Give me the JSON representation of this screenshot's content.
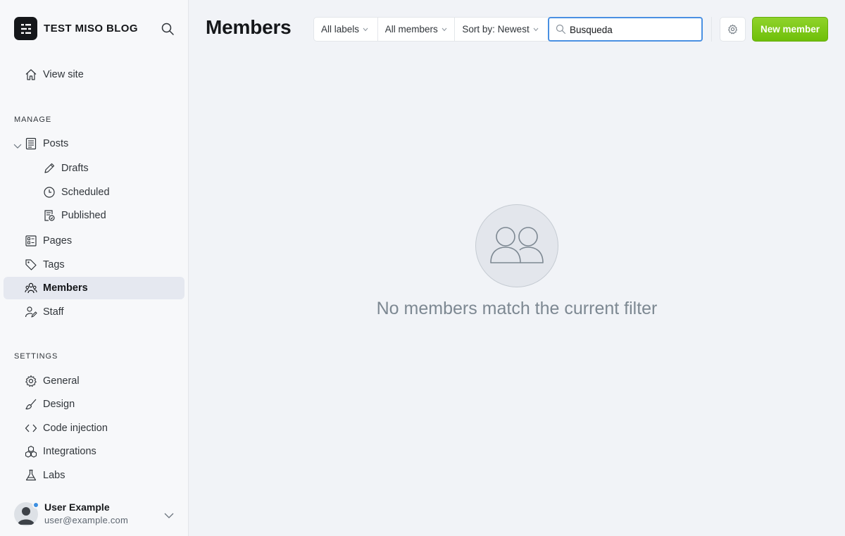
{
  "brand": {
    "title": "TEST MISO BLOG"
  },
  "sidebar": {
    "view_site": "View site",
    "manage_title": "MANAGE",
    "posts": "Posts",
    "posts_sub": [
      "Drafts",
      "Scheduled",
      "Published"
    ],
    "pages": "Pages",
    "tags": "Tags",
    "members": "Members",
    "staff": "Staff",
    "settings_title": "SETTINGS",
    "general": "General",
    "design": "Design",
    "code_injection": "Code injection",
    "integrations": "Integrations",
    "labs": "Labs"
  },
  "user": {
    "name": "User Example",
    "email": "user@example.com"
  },
  "main": {
    "title": "Members",
    "filters": [
      "All labels",
      "All members",
      "Sort by: Newest"
    ],
    "search_value": "Busqueda",
    "new_member_label": "New member",
    "empty_message": "No members match the current filter"
  },
  "colors": {
    "accent_green": "#7ac91a",
    "focus_blue": "#4a90e2",
    "active_nav": "#e5e8f0"
  }
}
